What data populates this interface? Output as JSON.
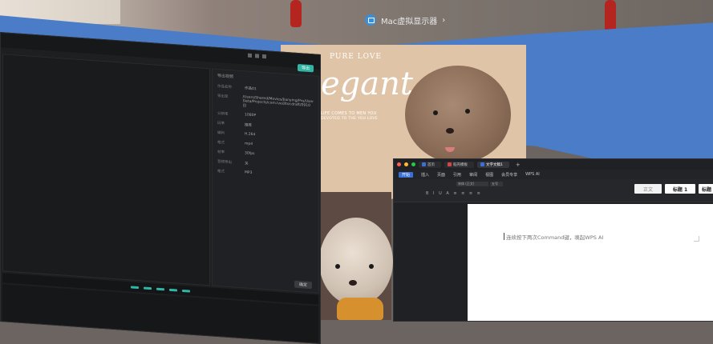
{
  "headset_bar": {
    "label": "Mac虚拟显示器",
    "chevron": "›"
  },
  "poster": {
    "title_small": "PURE LOVE",
    "title_script": "egant",
    "line1": "LIFE COMES TO MEN YOU",
    "line2": "DEVOTED TO THE YOU LOVE"
  },
  "editor": {
    "panel_title": "导出视频",
    "export_label": "导出",
    "ok_label": "确定",
    "props": [
      {
        "key": "作品名称",
        "value": "作品01"
      },
      {
        "key": "导出至",
        "value": "/Users/Shared/Movies/Jianying/Pro/User Data/Projects/com.lveditor.draft/0910日"
      },
      {
        "key": "分辨率",
        "value": "1080P"
      },
      {
        "key": "码率",
        "value": "推荐"
      },
      {
        "key": "编码",
        "value": "H.264"
      },
      {
        "key": "格式",
        "value": "mp4"
      },
      {
        "key": "帧率",
        "value": "30fps"
      },
      {
        "key": "音频导出",
        "value": "关"
      },
      {
        "key": "格式",
        "value": "MP3"
      }
    ]
  },
  "wps": {
    "tabs": [
      {
        "label": "首页",
        "color": "#3a6fd8"
      },
      {
        "label": "稻壳模板",
        "color": "#d64545"
      },
      {
        "label": "文字文稿1",
        "color": "#3a6fd8"
      }
    ],
    "new_tab": "+",
    "menu": [
      "开始",
      "插入",
      "页面",
      "引用",
      "审阅",
      "视图",
      "会员专享",
      "WPS AI"
    ],
    "menu_active": 0,
    "font_name": "宋体 (正文)",
    "font_size": "五号",
    "styles": {
      "normal": "正文",
      "h1": "标题 1",
      "h2": "标题"
    },
    "doc_prompt": "连续按下两次Command键，唤起WPS AI"
  },
  "colors": {
    "accent_teal": "#33b5a6",
    "wps_blue": "#3a6fd8",
    "virtual_display_blue": "#4a7cc7"
  }
}
